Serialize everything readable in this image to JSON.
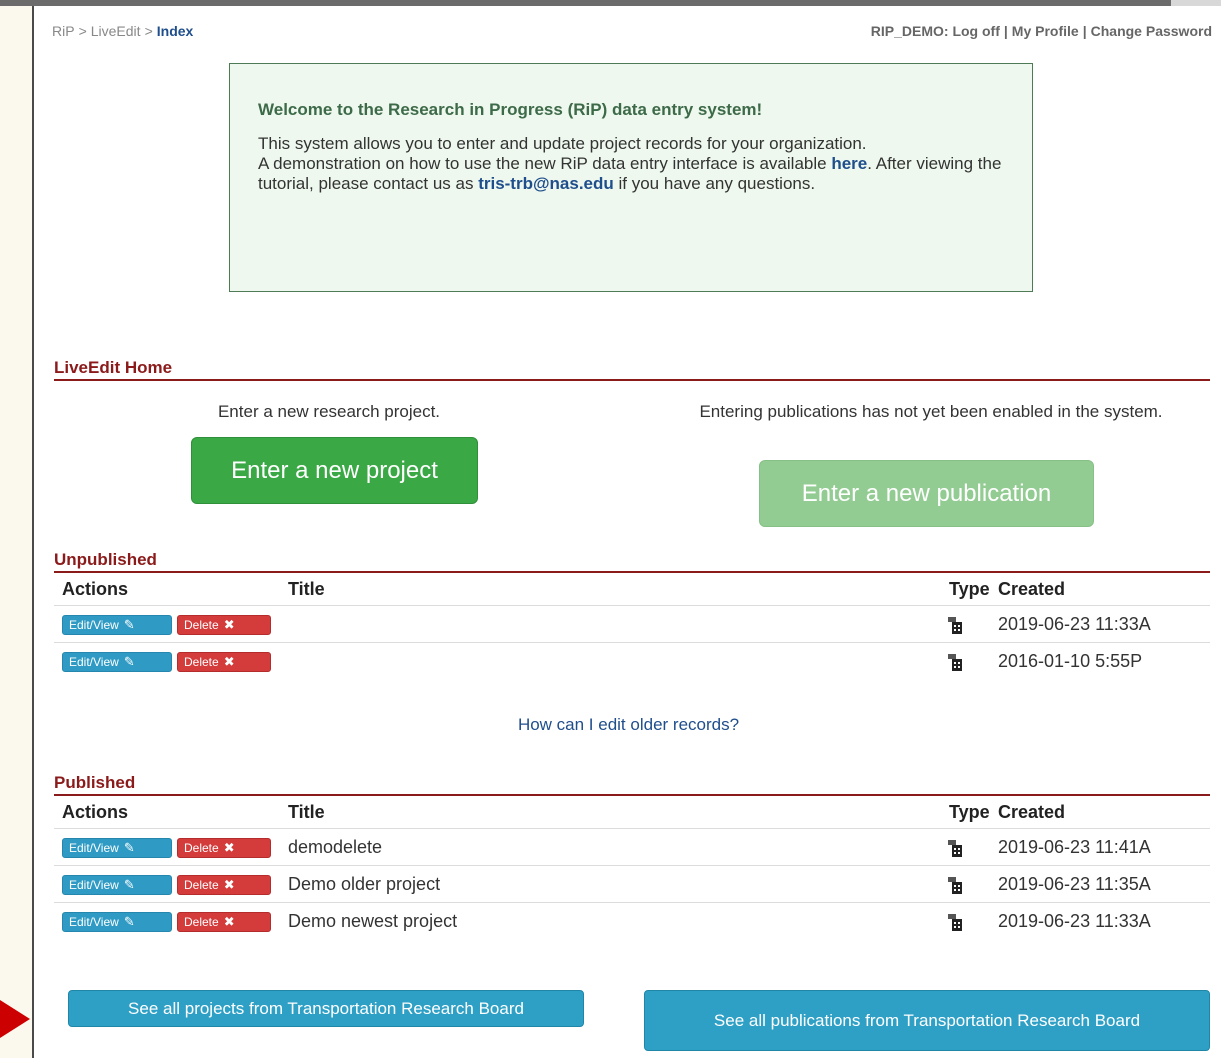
{
  "breadcrumb": {
    "items": [
      "RiP",
      "LiveEdit"
    ],
    "separator": ">",
    "current": "Index"
  },
  "user": {
    "name": "RIP_DEMO:",
    "links": [
      "Log off",
      "My Profile",
      "Change Password"
    ]
  },
  "welcome": {
    "title": "Welcome to the Research in Progress (RiP) data entry system!",
    "para1": "This system allows you to enter and update project records for your organization.",
    "para2_before": "A demonstration on how to use the new RiP data entry interface is available ",
    "here_link": "here",
    "para2_middle": ". After viewing the tutorial, please contact us as ",
    "email": "tris-trb@nas.edu",
    "para2_after": " if you have any questions."
  },
  "home": {
    "heading": "LiveEdit Home",
    "project_text": "Enter a new research project.",
    "project_button": "Enter a new project",
    "publication_text": "Entering publications has not yet been enabled in the system.",
    "publication_button": "Enter a new publication"
  },
  "columns": {
    "actions": "Actions",
    "title": "Title",
    "type": "Type",
    "created": "Created"
  },
  "row_buttons": {
    "edit": "Edit/View",
    "delete": "Delete"
  },
  "unpublished": {
    "heading": "Unpublished",
    "rows": [
      {
        "title": "",
        "created": "2019-06-23 11:33A"
      },
      {
        "title": "",
        "created": "2016-01-10 5:55P"
      }
    ]
  },
  "help_link": "How can I edit older records?",
  "published": {
    "heading": "Published",
    "rows": [
      {
        "title": "demodelete",
        "created": "2019-06-23 11:41A"
      },
      {
        "title": "Demo older project",
        "created": "2019-06-23 11:35A"
      },
      {
        "title": "Demo newest project",
        "created": "2019-06-23 11:33A"
      }
    ]
  },
  "footer": {
    "projects_button": "See all projects from Transportation Research Board",
    "publications_button": "See all publications from Transportation Research Board"
  },
  "colors": {
    "accent": "#8b1a1a",
    "link": "#1f4e8c",
    "green": "#3aa845",
    "blue": "#2ea0c6",
    "red": "#d43b3b"
  }
}
